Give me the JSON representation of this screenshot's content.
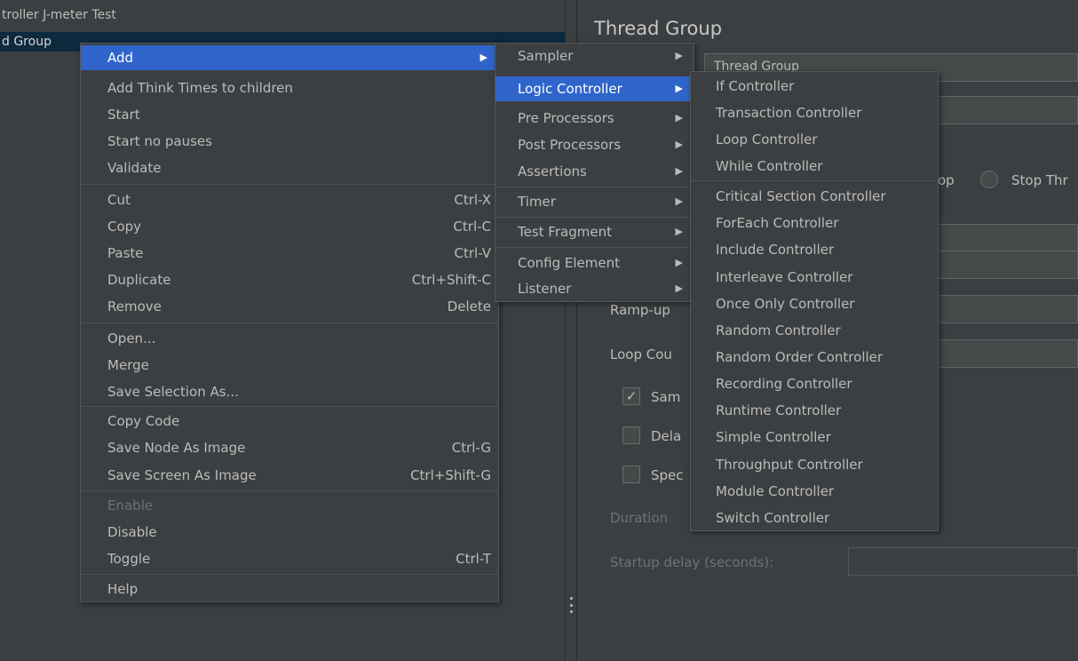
{
  "tree": {
    "row1": "troller J-meter Test",
    "row2": "d Group"
  },
  "right_panel": {
    "title": "Thread Group",
    "name_field_value": "Thread Group",
    "radio_label_partial": "op",
    "radio_label_stop_thread": "Stop Thr",
    "ramp_up_label": "Ramp-up",
    "loop_count_label": "Loop Cou",
    "same_user_label": "Sam",
    "delay_label": "Dela",
    "specify_label": "Spec",
    "duration_label": "Duration",
    "startup_delay_label": "Startup delay (seconds):"
  },
  "context_menu": {
    "items": [
      {
        "label": "Add",
        "shortcut": "",
        "submenu": true
      },
      {
        "label": "Add Think Times to children",
        "shortcut": ""
      },
      {
        "label": "Start",
        "shortcut": ""
      },
      {
        "label": "Start no pauses",
        "shortcut": ""
      },
      {
        "label": "Validate",
        "shortcut": ""
      },
      {
        "label": "Cut",
        "shortcut": "Ctrl-X"
      },
      {
        "label": "Copy",
        "shortcut": "Ctrl-C"
      },
      {
        "label": "Paste",
        "shortcut": "Ctrl-V"
      },
      {
        "label": "Duplicate",
        "shortcut": "Ctrl+Shift-C"
      },
      {
        "label": "Remove",
        "shortcut": "Delete"
      },
      {
        "label": "Open...",
        "shortcut": ""
      },
      {
        "label": "Merge",
        "shortcut": ""
      },
      {
        "label": "Save Selection As...",
        "shortcut": ""
      },
      {
        "label": "Copy Code",
        "shortcut": ""
      },
      {
        "label": "Save Node As Image",
        "shortcut": "Ctrl-G"
      },
      {
        "label": "Save Screen As Image",
        "shortcut": "Ctrl+Shift-G"
      },
      {
        "label": "Enable",
        "shortcut": "",
        "disabled": true
      },
      {
        "label": "Disable",
        "shortcut": ""
      },
      {
        "label": "Toggle",
        "shortcut": "Ctrl-T"
      },
      {
        "label": "Help",
        "shortcut": ""
      }
    ]
  },
  "add_submenu": {
    "items": [
      {
        "label": "Sampler"
      },
      {
        "label": "Logic Controller"
      },
      {
        "label": "Pre Processors"
      },
      {
        "label": "Post Processors"
      },
      {
        "label": "Assertions"
      },
      {
        "label": "Timer"
      },
      {
        "label": "Test Fragment"
      },
      {
        "label": "Config Element"
      },
      {
        "label": "Listener"
      }
    ]
  },
  "logic_submenu": {
    "items": [
      {
        "label": "If Controller"
      },
      {
        "label": "Transaction Controller"
      },
      {
        "label": "Loop Controller"
      },
      {
        "label": "While Controller"
      },
      {
        "label": "Critical Section Controller"
      },
      {
        "label": "ForEach Controller"
      },
      {
        "label": "Include Controller"
      },
      {
        "label": "Interleave Controller"
      },
      {
        "label": "Once Only Controller"
      },
      {
        "label": "Random Controller"
      },
      {
        "label": "Random Order Controller"
      },
      {
        "label": "Recording Controller"
      },
      {
        "label": "Runtime Controller"
      },
      {
        "label": "Simple Controller"
      },
      {
        "label": "Throughput Controller"
      },
      {
        "label": "Module Controller"
      },
      {
        "label": "Switch Controller"
      }
    ]
  },
  "colors": {
    "background": "#3c3f41",
    "selection": "#2f65ca",
    "tree_selection": "#0d293e",
    "text": "#bbbbbb"
  }
}
